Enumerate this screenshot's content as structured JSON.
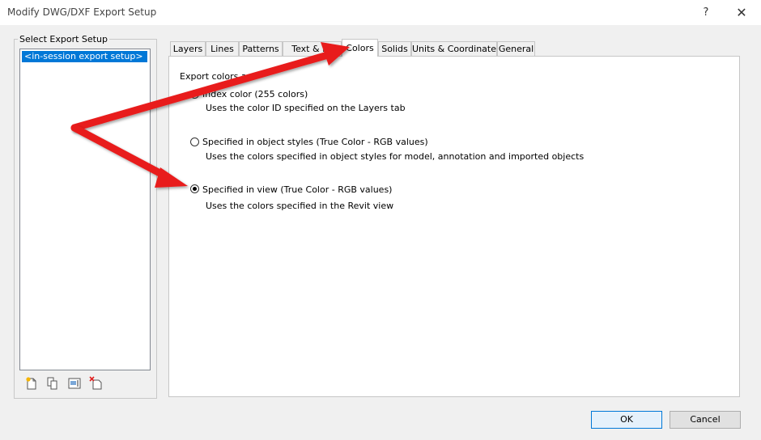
{
  "window": {
    "title": "Modify DWG/DXF Export Setup",
    "help_label": "?",
    "close_label": "✕"
  },
  "sidebar": {
    "group_label": "Select Export Setup",
    "items": [
      "<in-session export setup>"
    ],
    "toolbar_icons": [
      "new-setup-icon",
      "duplicate-setup-icon",
      "rename-setup-icon",
      "delete-setup-icon"
    ]
  },
  "tabs": [
    {
      "label": "Layers"
    },
    {
      "label": "Lines"
    },
    {
      "label": "Patterns"
    },
    {
      "label": "Text & Fo"
    },
    {
      "label": "Colors",
      "active": true
    },
    {
      "label": "Solids"
    },
    {
      "label": "Units & Coordinates"
    },
    {
      "label": "General"
    }
  ],
  "colors_tab": {
    "section_label": "Export colors as:",
    "options": [
      {
        "label": "Index color (255 colors)",
        "description": "Uses the color ID specified on the Layers tab",
        "selected": false
      },
      {
        "label": "Specified in object styles (True Color - RGB values)",
        "description": "Uses the colors specified in object styles for model, annotation and imported objects",
        "selected": false
      },
      {
        "label": "Specified in view (True Color - RGB values)",
        "description": "Uses the colors specified in the Revit view",
        "selected": true
      }
    ]
  },
  "buttons": {
    "ok": "OK",
    "cancel": "Cancel"
  },
  "colors": {
    "accent": "#0078d7",
    "arrow": "#e81e1e"
  }
}
